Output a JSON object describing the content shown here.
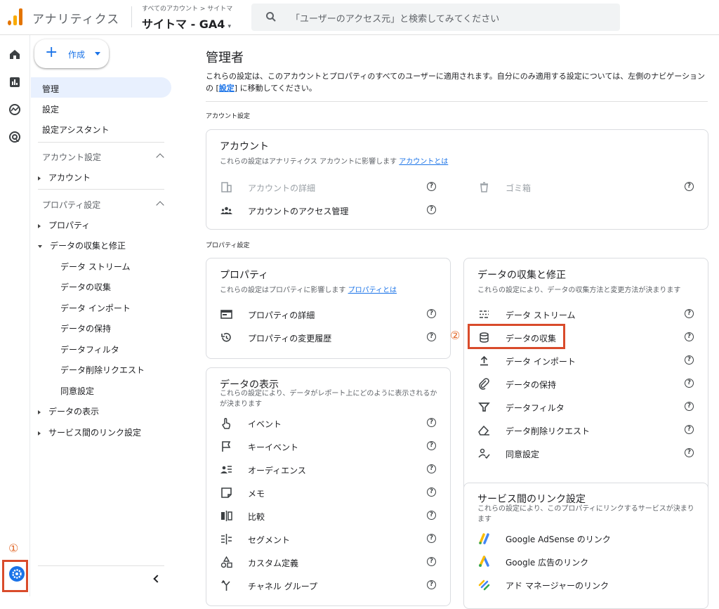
{
  "header": {
    "app_title": "アナリティクス",
    "breadcrumb": "すべてのアカウント > サイトマ",
    "property": "サイトマ - GA4",
    "search_placeholder": "「ユーザーのアクセス元」と検索してみてください"
  },
  "annotations": {
    "mark1": "①",
    "mark2": "②"
  },
  "nav": {
    "create_label": "作成",
    "items": {
      "admin": "管理",
      "settings": "設定",
      "assistant": "設定アシスタント"
    },
    "account_section": "アカウント設定",
    "account": "アカウント",
    "property_section": "プロパティ設定",
    "property": "プロパティ",
    "data_collection_parent": "データの収集と修正",
    "sub": {
      "stream": "データ ストリーム",
      "collection": "データの収集",
      "import": "データ インポート",
      "retention": "データの保持",
      "filter": "データフィルタ",
      "deletion": "データ削除リクエスト",
      "consent": "同意設定"
    },
    "display": "データの表示",
    "links": "サービス間のリンク設定"
  },
  "main": {
    "title": "管理者",
    "desc_part1": "これらの設定は、このアカウントとプロパティのすべてのユーザーに適用されます。自分にのみ適用する設定については、左側のナビゲーションの [",
    "desc_link": "設定",
    "desc_part2": "] に移動してください。",
    "account_settings_label": "アカウント設定",
    "property_settings_label": "プロパティ設定"
  },
  "account_card": {
    "title": "アカウント",
    "desc": "これらの設定はアナリティクス アカウントに影響します",
    "desc_link": "アカウントとは",
    "rows": {
      "details": "アカウントの詳細",
      "trash": "ゴミ箱",
      "access": "アカウントのアクセス管理"
    }
  },
  "property_card": {
    "title": "プロパティ",
    "desc": "これらの設定はプロパティに影響します",
    "desc_link": "プロパティとは",
    "rows": {
      "details": "プロパティの詳細",
      "history": "プロパティの変更履歴"
    }
  },
  "collection_card": {
    "title": "データの収集と修正",
    "desc": "これらの設定により、データの収集方法と変更方法が決まります",
    "rows": {
      "stream": "データ ストリーム",
      "collection": "データの収集",
      "import": "データ インポート",
      "retention": "データの保持",
      "filter": "データフィルタ",
      "deletion": "データ削除リクエスト",
      "consent": "同意設定"
    }
  },
  "display_card": {
    "title": "データの表示",
    "desc": "これらの設定により、データがレポート上にどのように表示されるかが決まります",
    "rows": {
      "events": "イベント",
      "key_events": "キーイベント",
      "audiences": "オーディエンス",
      "notes": "メモ",
      "comparisons": "比較",
      "segments": "セグメント",
      "custom": "カスタム定義",
      "channel": "チャネル グループ"
    }
  },
  "links_card": {
    "title": "サービス間のリンク設定",
    "desc": "これらの設定により、このプロパティにリンクするサービスが決まります",
    "rows": {
      "adsense": "Google AdSense のリンク",
      "ads": "Google 広告のリンク",
      "admanager": "アド マネージャーのリンク"
    }
  },
  "help_glyph": "?",
  "colors": {
    "accent": "#1a73e8",
    "highlight": "#d94b2b",
    "annotation": "#e2692a"
  }
}
